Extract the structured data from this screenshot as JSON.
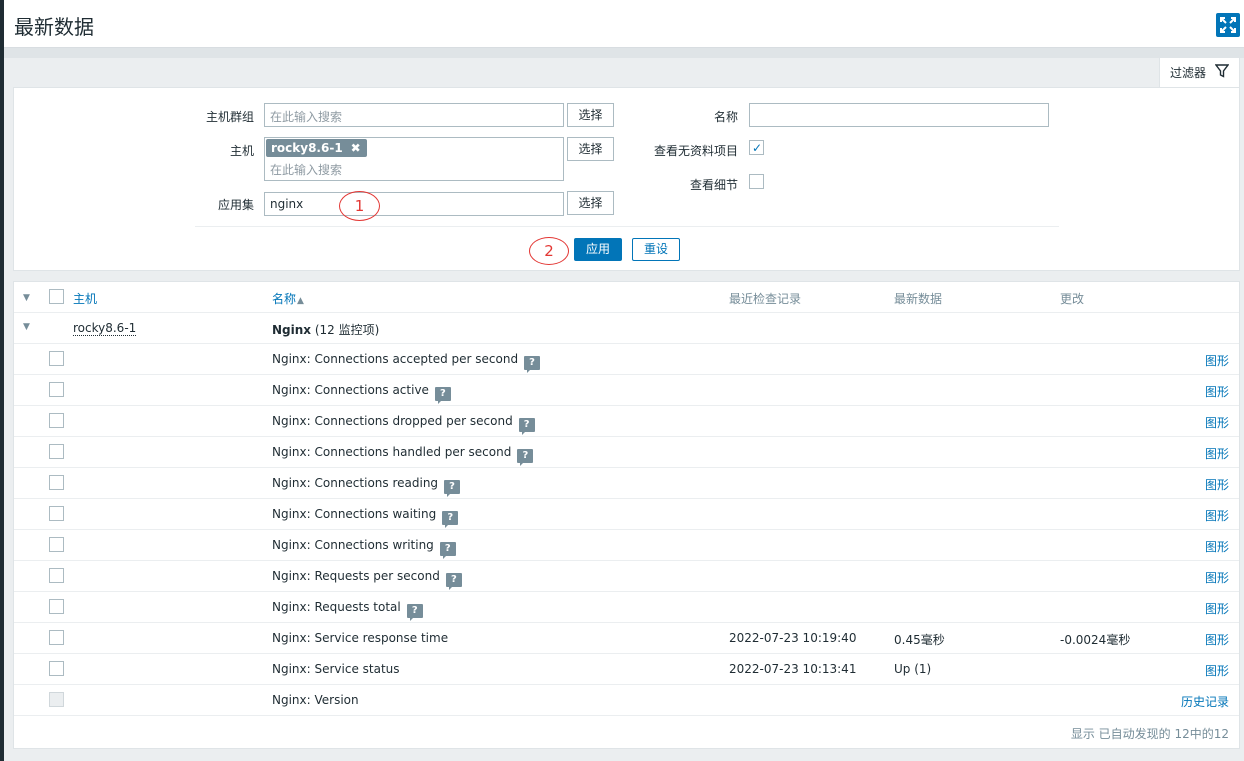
{
  "page": {
    "title": "最新数据"
  },
  "filter": {
    "tab_label": "过滤器",
    "hostgroup_label": "主机群组",
    "hostgroup_placeholder": "在此输入搜索",
    "host_label": "主机",
    "host_chip": "rocky8.6-1",
    "host_placeholder": "在此输入搜索",
    "app_label": "应用集",
    "app_value": "nginx",
    "select_label": "选择",
    "name_label": "名称",
    "name_value": "",
    "show_without_data_label": "查看无资料项目",
    "show_without_data_checked": true,
    "show_details_label": "查看细节",
    "show_details_checked": false,
    "apply_label": "应用",
    "reset_label": "重设",
    "annotation_1": "1",
    "annotation_2": "2"
  },
  "table": {
    "headers": {
      "host": "主机",
      "name": "名称",
      "sort_indicator": "▲",
      "last_check": "最近检查记录",
      "last_value": "最新数据",
      "change": "更改"
    },
    "group": {
      "host": "rocky8.6-1",
      "app_name": "Nginx",
      "count": "(12 监控项)"
    },
    "rows": [
      {
        "name": "Nginx: Connections accepted per second",
        "help": true,
        "last_check": "",
        "last_value": "",
        "change": "",
        "link": "图形",
        "disabled": false
      },
      {
        "name": "Nginx: Connections active",
        "help": true,
        "last_check": "",
        "last_value": "",
        "change": "",
        "link": "图形",
        "disabled": false
      },
      {
        "name": "Nginx: Connections dropped per second",
        "help": true,
        "last_check": "",
        "last_value": "",
        "change": "",
        "link": "图形",
        "disabled": false
      },
      {
        "name": "Nginx: Connections handled per second",
        "help": true,
        "last_check": "",
        "last_value": "",
        "change": "",
        "link": "图形",
        "disabled": false
      },
      {
        "name": "Nginx: Connections reading",
        "help": true,
        "last_check": "",
        "last_value": "",
        "change": "",
        "link": "图形",
        "disabled": false
      },
      {
        "name": "Nginx: Connections waiting",
        "help": true,
        "last_check": "",
        "last_value": "",
        "change": "",
        "link": "图形",
        "disabled": false
      },
      {
        "name": "Nginx: Connections writing",
        "help": true,
        "last_check": "",
        "last_value": "",
        "change": "",
        "link": "图形",
        "disabled": false
      },
      {
        "name": "Nginx: Requests per second",
        "help": true,
        "last_check": "",
        "last_value": "",
        "change": "",
        "link": "图形",
        "disabled": false
      },
      {
        "name": "Nginx: Requests total",
        "help": true,
        "last_check": "",
        "last_value": "",
        "change": "",
        "link": "图形",
        "disabled": false
      },
      {
        "name": "Nginx: Service response time",
        "help": false,
        "last_check": "2022-07-23 10:19:40",
        "last_value": "0.45毫秒",
        "change": "-0.0024毫秒",
        "link": "图形",
        "disabled": false
      },
      {
        "name": "Nginx: Service status",
        "help": false,
        "last_check": "2022-07-23 10:13:41",
        "last_value": "Up (1)",
        "change": "",
        "link": "图形",
        "disabled": false
      },
      {
        "name": "Nginx: Version",
        "help": false,
        "last_check": "",
        "last_value": "",
        "change": "",
        "link": "历史记录",
        "disabled": true
      }
    ],
    "help_glyph": "?",
    "footer": "显示 已自动发现的 12中的12"
  }
}
